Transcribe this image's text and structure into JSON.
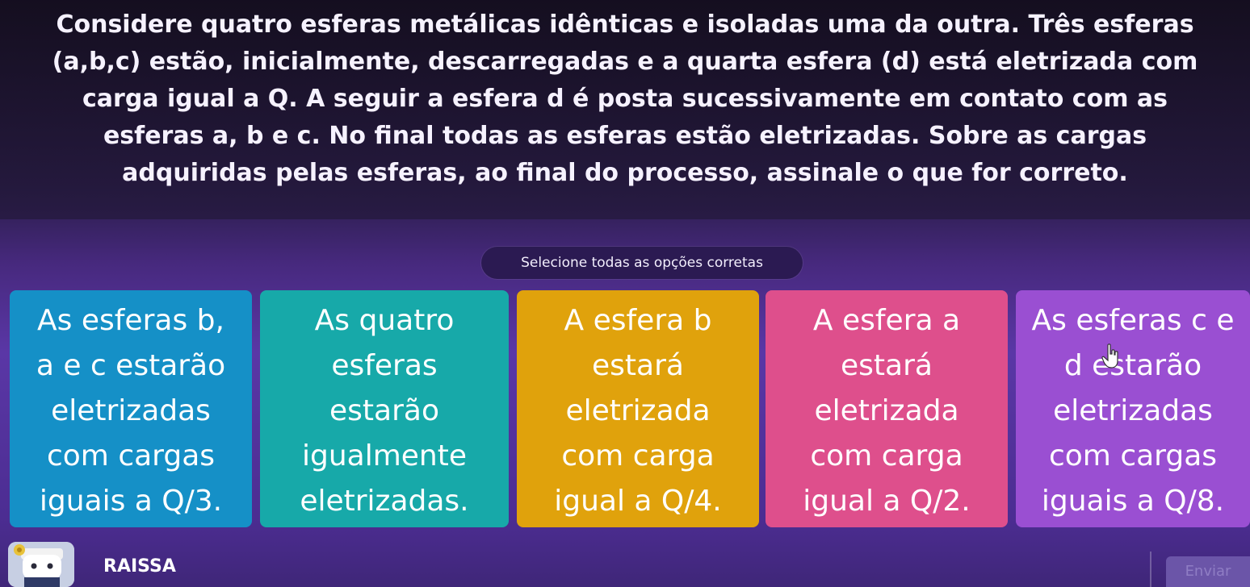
{
  "question": {
    "text": "Considere quatro esferas metálicas idênticas e isoladas uma da outra. Três esferas (a,b,c) estão, inicialmente, descarregadas e a quarta esfera (d) está eletrizada com carga igual a Q. A seguir a esfera d é posta sucessivamente em contato com as esferas a, b e c. No final todas as esferas estão eletrizadas. Sobre as cargas adquiridas pelas esferas, ao final do processo, assinale o que for correto."
  },
  "instruction": "Selecione todas as opções corretas",
  "options": [
    {
      "text": "As esferas b,\na e c estarão\neletrizadas\ncom cargas\niguais a Q/3.",
      "color": "#1590c7"
    },
    {
      "text": "As quatro\nesferas\nestarão\nigualmente\neletrizadas.",
      "color": "#17a9a9"
    },
    {
      "text": "A esfera b\nestará\neletrizada\ncom carga\nigual a Q/4.",
      "color": "#e0a20c"
    },
    {
      "text": "A esfera a\nestará\neletrizada\ncom carga\nigual a Q/2.",
      "color": "#de4f8c"
    },
    {
      "text": "As esferas c e\nd estarão\neletrizadas\ncom cargas\niguais a Q/8.",
      "color": "#9a4fd2"
    }
  ],
  "footer": {
    "player_name": "RAISSA",
    "avatar_icon": "avatar-character",
    "submit_label": "Enviar"
  },
  "colors": {
    "background": "#4c2d92",
    "pill": "#2b1a52"
  }
}
